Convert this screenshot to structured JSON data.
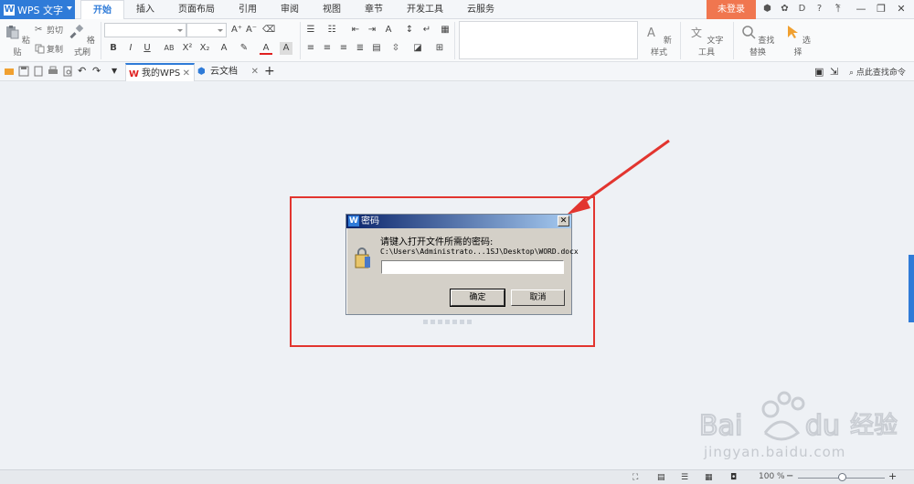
{
  "app": {
    "name": "WPS 文字",
    "logo_letter": "W",
    "login_label": "未登录"
  },
  "menu": {
    "tabs": [
      {
        "label": "开始",
        "active": true
      },
      {
        "label": "插入"
      },
      {
        "label": "页面布局"
      },
      {
        "label": "引用"
      },
      {
        "label": "审阅"
      },
      {
        "label": "视图"
      },
      {
        "label": "章节"
      },
      {
        "label": "开发工具"
      },
      {
        "label": "云服务"
      }
    ]
  },
  "ribbon": {
    "paste": "粘贴",
    "cut": "剪切",
    "copy": "复制",
    "format_painter": "格式刷",
    "new_style": "新样式",
    "text_tools": "文字工具",
    "find_replace": "查找替换",
    "select": "选择"
  },
  "doc_tabs": [
    {
      "label": "我的WPS",
      "active": true
    },
    {
      "label": "云文档"
    }
  ],
  "search_command": "点此查找命令",
  "dialog": {
    "title": "密码",
    "title_icon_letter": "W",
    "prompt": "请键入打开文件所需的密码:",
    "file_path": "C:\\Users\\Administrato...1SJ\\Desktop\\WORD.docx",
    "password_value": "",
    "ok_label": "确定",
    "cancel_label": "取消"
  },
  "status": {
    "zoom_text": "100 %",
    "zoom_level_fraction": 0.5
  },
  "watermark": {
    "brand": "Bai",
    "brand_suffix": "du",
    "cn": "经验",
    "url": "jingyan.baidu.com"
  },
  "colors": {
    "accent": "#2f7bd8",
    "login": "#f0764f",
    "highlight_box": "#e2352f"
  }
}
